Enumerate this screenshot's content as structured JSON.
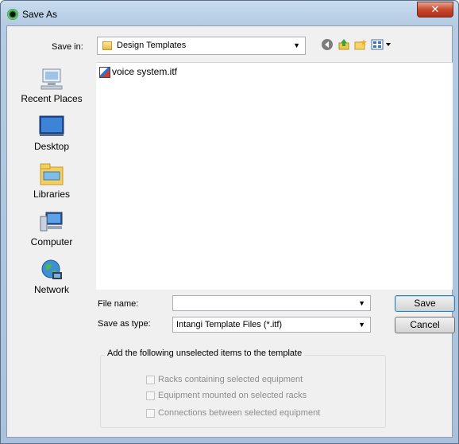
{
  "window": {
    "title": "Save As"
  },
  "save_in": {
    "label": "Save in:",
    "value": "Design Templates"
  },
  "places": [
    {
      "label": "Recent Places",
      "icon": "recent-places-icon"
    },
    {
      "label": "Desktop",
      "icon": "desktop-icon"
    },
    {
      "label": "Libraries",
      "icon": "libraries-icon"
    },
    {
      "label": "Computer",
      "icon": "computer-icon"
    },
    {
      "label": "Network",
      "icon": "network-icon"
    }
  ],
  "files": [
    {
      "name": "voice system.itf",
      "icon": "itf-file-icon"
    }
  ],
  "file_name": {
    "label": "File name:",
    "value": ""
  },
  "save_as_type": {
    "label": "Save as type:",
    "value": "Intangi Template Files (*.itf)"
  },
  "buttons": {
    "save": "Save",
    "cancel": "Cancel"
  },
  "options": {
    "title": "Add the following unselected items to the template",
    "items": [
      {
        "label": "Racks containing selected equipment",
        "checked": false,
        "enabled": false
      },
      {
        "label": "Equipment mounted on selected racks",
        "checked": false,
        "enabled": false
      },
      {
        "label": "Connections between selected equipment",
        "checked": false,
        "enabled": false
      }
    ]
  }
}
